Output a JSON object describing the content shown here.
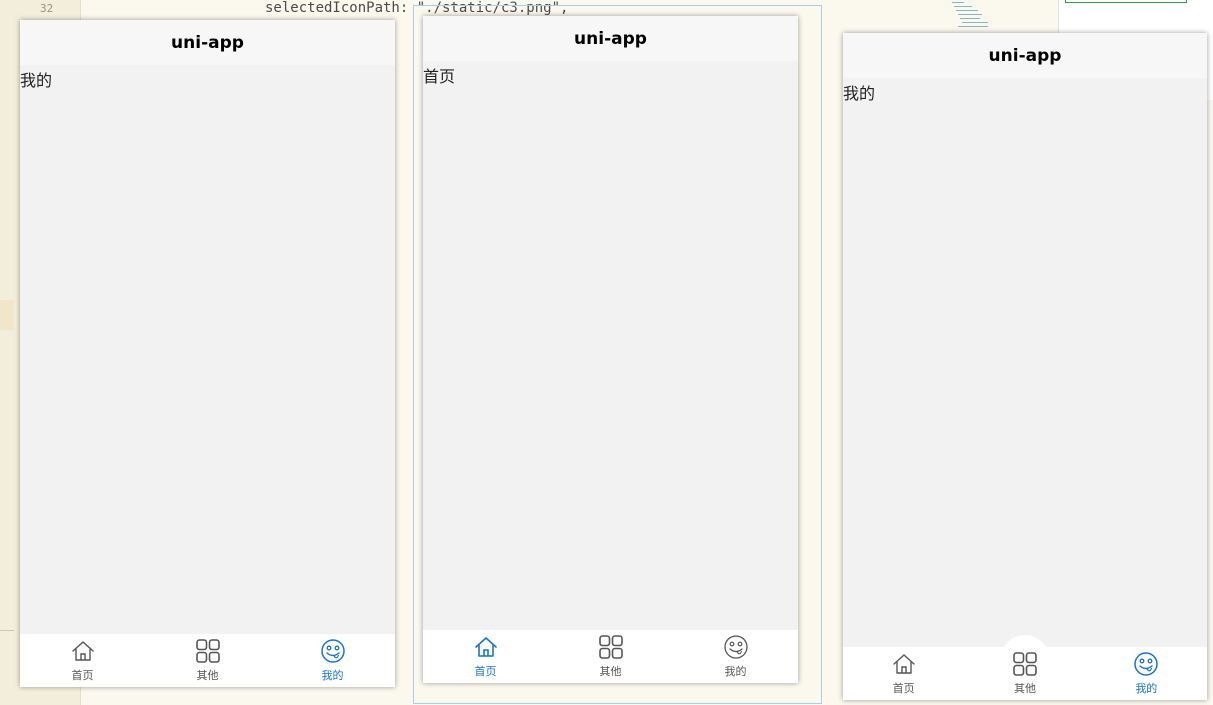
{
  "background": {
    "line_number": "32",
    "code_fragment": "selectedIconPath: \"./static/c3.png\","
  },
  "colors": {
    "active": "#1a73c8",
    "inactive": "#555555",
    "title": "#000000",
    "page_bg": "#f2f2f2"
  },
  "phones": [
    {
      "title": "uni-app",
      "page_text": "我的",
      "tabs": [
        {
          "label": "首页",
          "icon": "home-icon",
          "active": false
        },
        {
          "label": "其他",
          "icon": "grid-icon",
          "active": false
        },
        {
          "label": "我的",
          "icon": "smiley-icon",
          "active": true
        }
      ]
    },
    {
      "title": "uni-app",
      "page_text": "首页",
      "tabs": [
        {
          "label": "首页",
          "icon": "home-icon",
          "active": true
        },
        {
          "label": "其他",
          "icon": "grid-icon",
          "active": false
        },
        {
          "label": "我的",
          "icon": "smiley-icon",
          "active": false
        }
      ]
    },
    {
      "title": "uni-app",
      "page_text": "我的",
      "tabs": [
        {
          "label": "首页",
          "icon": "home-icon",
          "active": false
        },
        {
          "label": "其他",
          "icon": "grid-icon",
          "active": false,
          "raised": true
        },
        {
          "label": "我的",
          "icon": "smiley-icon",
          "active": true
        }
      ]
    }
  ]
}
